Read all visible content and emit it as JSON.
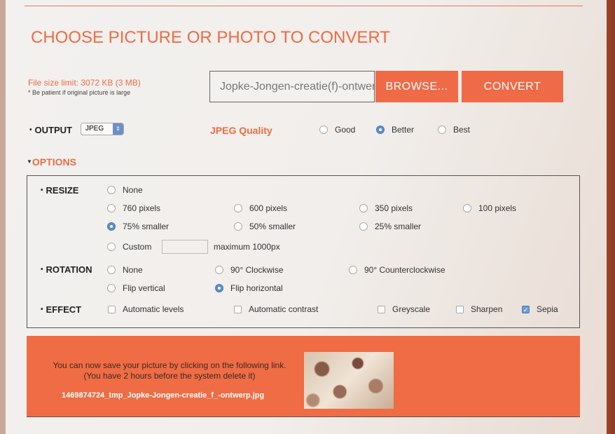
{
  "title": "CHOOSE PICTURE OR PHOTO TO CONVERT",
  "upload": {
    "limit": "File size limit: 3072 KB (3 MB)",
    "note": "* Be patient if original picture is large",
    "file_value": "Jopke-Jongen-creatie(f)-ontwerp.jpg",
    "browse": "BROWSE...",
    "convert": "CONVERT"
  },
  "output": {
    "label": "OUTPUT",
    "format": "JPEG",
    "quality_label": "JPEG Quality",
    "quality": [
      {
        "label": "Good",
        "checked": false
      },
      {
        "label": "Better",
        "checked": true
      },
      {
        "label": "Best",
        "checked": false
      }
    ]
  },
  "options_label": "OPTIONS",
  "resize": {
    "label": "RESIZE",
    "none": "None",
    "o760": "760 pixels",
    "o600": "600 pixels",
    "o350": "350 pixels",
    "o100": "100 pixels",
    "p75": "75% smaller",
    "p50": "50% smaller",
    "p25": "25% smaller",
    "custom": "Custom",
    "custom_value": "",
    "max": "maximum 1000px",
    "selected": "75% smaller"
  },
  "rotation": {
    "label": "ROTATION",
    "none": "None",
    "cw": "90° Clockwise",
    "ccw": "90° Counterclockwise",
    "fv": "Flip vertical",
    "fh": "Flip horizontal",
    "selected": "Flip horizontal"
  },
  "effect": {
    "label": "EFFECT",
    "levels": "Automatic levels",
    "contrast": "Automatic contrast",
    "grey": "Greyscale",
    "sharpen": "Sharpen",
    "sepia": "Sepia",
    "checked": [
      "Sepia"
    ]
  },
  "result": {
    "line1": "You can now save your picture by clicking on the following link.",
    "line2": "(You have 2 hours before the system delete it)",
    "link": "1469874724_tmp_Jopke-Jongen-creatie_f_-ontwerp.jpg"
  },
  "colors": {
    "accent": "#ef6c45",
    "radio_selected": "#5b8fd1"
  }
}
